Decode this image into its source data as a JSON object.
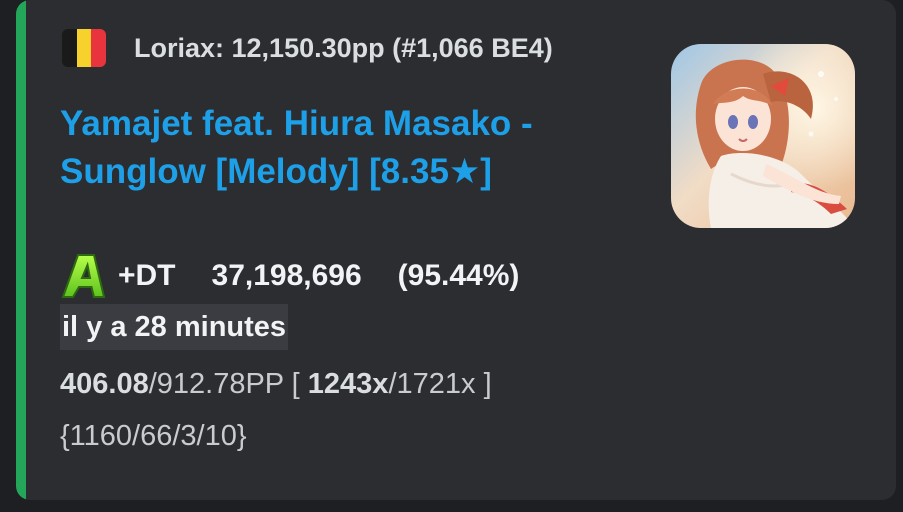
{
  "embed": {
    "accent_color": "#23a55a",
    "flag": {
      "icon": "belgium-flag-icon",
      "colors": [
        "#1a1a1a",
        "#f7d22c",
        "#e8343c"
      ]
    },
    "author": "Loriax: 12,150.30pp (#1,066 BE4)",
    "title_line1": "Yamajet feat. Hiura Masako -",
    "title_line2": "Sunglow [Melody] [8.35★]",
    "title_color": "#1ea0e8",
    "thumbnail": "anime-girl-cover-art"
  },
  "score": {
    "rank_icon": "rank-a-icon",
    "rank_letter": "A",
    "mods": "+DT",
    "points": "37,198,696",
    "accuracy": "(95.44%)",
    "time_ago": "il y a 28 minutes",
    "pp_current": "406.08",
    "pp_max": "/912.78PP [ ",
    "combo_current": "1243x",
    "combo_max": "/1721x ]",
    "hits": "{1160/66/3/10}"
  }
}
